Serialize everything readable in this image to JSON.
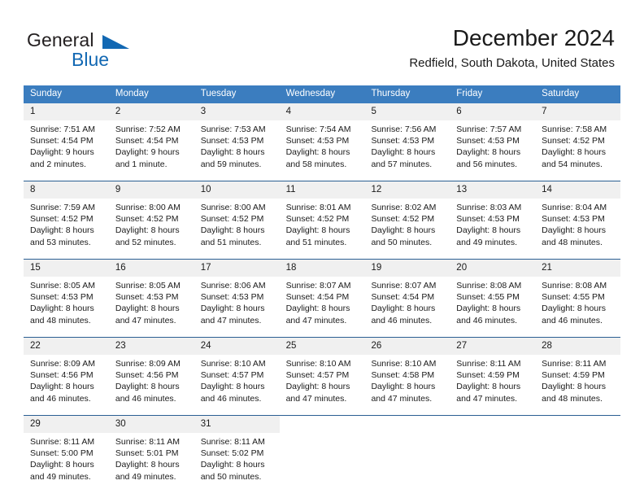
{
  "brand": {
    "name_part1": "General",
    "name_part2": "Blue",
    "triangle_icon": "triangle-icon",
    "accent_color": "#1268b3"
  },
  "header": {
    "title": "December 2024",
    "subtitle": "Redfield, South Dakota, United States"
  },
  "calendar": {
    "header_bg": "#3b7dbf",
    "header_text_color": "#ffffff",
    "daynum_bg": "#f0f0f0",
    "weekdays": [
      "Sunday",
      "Monday",
      "Tuesday",
      "Wednesday",
      "Thursday",
      "Friday",
      "Saturday"
    ],
    "weeks": [
      [
        {
          "day": "1",
          "sunrise": "Sunrise: 7:51 AM",
          "sunset": "Sunset: 4:54 PM",
          "daylight_line1": "Daylight: 9 hours",
          "daylight_line2": "and 2 minutes."
        },
        {
          "day": "2",
          "sunrise": "Sunrise: 7:52 AM",
          "sunset": "Sunset: 4:54 PM",
          "daylight_line1": "Daylight: 9 hours",
          "daylight_line2": "and 1 minute."
        },
        {
          "day": "3",
          "sunrise": "Sunrise: 7:53 AM",
          "sunset": "Sunset: 4:53 PM",
          "daylight_line1": "Daylight: 8 hours",
          "daylight_line2": "and 59 minutes."
        },
        {
          "day": "4",
          "sunrise": "Sunrise: 7:54 AM",
          "sunset": "Sunset: 4:53 PM",
          "daylight_line1": "Daylight: 8 hours",
          "daylight_line2": "and 58 minutes."
        },
        {
          "day": "5",
          "sunrise": "Sunrise: 7:56 AM",
          "sunset": "Sunset: 4:53 PM",
          "daylight_line1": "Daylight: 8 hours",
          "daylight_line2": "and 57 minutes."
        },
        {
          "day": "6",
          "sunrise": "Sunrise: 7:57 AM",
          "sunset": "Sunset: 4:53 PM",
          "daylight_line1": "Daylight: 8 hours",
          "daylight_line2": "and 56 minutes."
        },
        {
          "day": "7",
          "sunrise": "Sunrise: 7:58 AM",
          "sunset": "Sunset: 4:52 PM",
          "daylight_line1": "Daylight: 8 hours",
          "daylight_line2": "and 54 minutes."
        }
      ],
      [
        {
          "day": "8",
          "sunrise": "Sunrise: 7:59 AM",
          "sunset": "Sunset: 4:52 PM",
          "daylight_line1": "Daylight: 8 hours",
          "daylight_line2": "and 53 minutes."
        },
        {
          "day": "9",
          "sunrise": "Sunrise: 8:00 AM",
          "sunset": "Sunset: 4:52 PM",
          "daylight_line1": "Daylight: 8 hours",
          "daylight_line2": "and 52 minutes."
        },
        {
          "day": "10",
          "sunrise": "Sunrise: 8:00 AM",
          "sunset": "Sunset: 4:52 PM",
          "daylight_line1": "Daylight: 8 hours",
          "daylight_line2": "and 51 minutes."
        },
        {
          "day": "11",
          "sunrise": "Sunrise: 8:01 AM",
          "sunset": "Sunset: 4:52 PM",
          "daylight_line1": "Daylight: 8 hours",
          "daylight_line2": "and 51 minutes."
        },
        {
          "day": "12",
          "sunrise": "Sunrise: 8:02 AM",
          "sunset": "Sunset: 4:52 PM",
          "daylight_line1": "Daylight: 8 hours",
          "daylight_line2": "and 50 minutes."
        },
        {
          "day": "13",
          "sunrise": "Sunrise: 8:03 AM",
          "sunset": "Sunset: 4:53 PM",
          "daylight_line1": "Daylight: 8 hours",
          "daylight_line2": "and 49 minutes."
        },
        {
          "day": "14",
          "sunrise": "Sunrise: 8:04 AM",
          "sunset": "Sunset: 4:53 PM",
          "daylight_line1": "Daylight: 8 hours",
          "daylight_line2": "and 48 minutes."
        }
      ],
      [
        {
          "day": "15",
          "sunrise": "Sunrise: 8:05 AM",
          "sunset": "Sunset: 4:53 PM",
          "daylight_line1": "Daylight: 8 hours",
          "daylight_line2": "and 48 minutes."
        },
        {
          "day": "16",
          "sunrise": "Sunrise: 8:05 AM",
          "sunset": "Sunset: 4:53 PM",
          "daylight_line1": "Daylight: 8 hours",
          "daylight_line2": "and 47 minutes."
        },
        {
          "day": "17",
          "sunrise": "Sunrise: 8:06 AM",
          "sunset": "Sunset: 4:53 PM",
          "daylight_line1": "Daylight: 8 hours",
          "daylight_line2": "and 47 minutes."
        },
        {
          "day": "18",
          "sunrise": "Sunrise: 8:07 AM",
          "sunset": "Sunset: 4:54 PM",
          "daylight_line1": "Daylight: 8 hours",
          "daylight_line2": "and 47 minutes."
        },
        {
          "day": "19",
          "sunrise": "Sunrise: 8:07 AM",
          "sunset": "Sunset: 4:54 PM",
          "daylight_line1": "Daylight: 8 hours",
          "daylight_line2": "and 46 minutes."
        },
        {
          "day": "20",
          "sunrise": "Sunrise: 8:08 AM",
          "sunset": "Sunset: 4:55 PM",
          "daylight_line1": "Daylight: 8 hours",
          "daylight_line2": "and 46 minutes."
        },
        {
          "day": "21",
          "sunrise": "Sunrise: 8:08 AM",
          "sunset": "Sunset: 4:55 PM",
          "daylight_line1": "Daylight: 8 hours",
          "daylight_line2": "and 46 minutes."
        }
      ],
      [
        {
          "day": "22",
          "sunrise": "Sunrise: 8:09 AM",
          "sunset": "Sunset: 4:56 PM",
          "daylight_line1": "Daylight: 8 hours",
          "daylight_line2": "and 46 minutes."
        },
        {
          "day": "23",
          "sunrise": "Sunrise: 8:09 AM",
          "sunset": "Sunset: 4:56 PM",
          "daylight_line1": "Daylight: 8 hours",
          "daylight_line2": "and 46 minutes."
        },
        {
          "day": "24",
          "sunrise": "Sunrise: 8:10 AM",
          "sunset": "Sunset: 4:57 PM",
          "daylight_line1": "Daylight: 8 hours",
          "daylight_line2": "and 46 minutes."
        },
        {
          "day": "25",
          "sunrise": "Sunrise: 8:10 AM",
          "sunset": "Sunset: 4:57 PM",
          "daylight_line1": "Daylight: 8 hours",
          "daylight_line2": "and 47 minutes."
        },
        {
          "day": "26",
          "sunrise": "Sunrise: 8:10 AM",
          "sunset": "Sunset: 4:58 PM",
          "daylight_line1": "Daylight: 8 hours",
          "daylight_line2": "and 47 minutes."
        },
        {
          "day": "27",
          "sunrise": "Sunrise: 8:11 AM",
          "sunset": "Sunset: 4:59 PM",
          "daylight_line1": "Daylight: 8 hours",
          "daylight_line2": "and 47 minutes."
        },
        {
          "day": "28",
          "sunrise": "Sunrise: 8:11 AM",
          "sunset": "Sunset: 4:59 PM",
          "daylight_line1": "Daylight: 8 hours",
          "daylight_line2": "and 48 minutes."
        }
      ],
      [
        {
          "day": "29",
          "sunrise": "Sunrise: 8:11 AM",
          "sunset": "Sunset: 5:00 PM",
          "daylight_line1": "Daylight: 8 hours",
          "daylight_line2": "and 49 minutes."
        },
        {
          "day": "30",
          "sunrise": "Sunrise: 8:11 AM",
          "sunset": "Sunset: 5:01 PM",
          "daylight_line1": "Daylight: 8 hours",
          "daylight_line2": "and 49 minutes."
        },
        {
          "day": "31",
          "sunrise": "Sunrise: 8:11 AM",
          "sunset": "Sunset: 5:02 PM",
          "daylight_line1": "Daylight: 8 hours",
          "daylight_line2": "and 50 minutes."
        },
        {
          "day": "",
          "sunrise": "",
          "sunset": "",
          "daylight_line1": "",
          "daylight_line2": ""
        },
        {
          "day": "",
          "sunrise": "",
          "sunset": "",
          "daylight_line1": "",
          "daylight_line2": ""
        },
        {
          "day": "",
          "sunrise": "",
          "sunset": "",
          "daylight_line1": "",
          "daylight_line2": ""
        },
        {
          "day": "",
          "sunrise": "",
          "sunset": "",
          "daylight_line1": "",
          "daylight_line2": ""
        }
      ]
    ]
  }
}
